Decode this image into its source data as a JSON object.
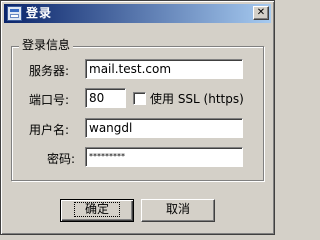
{
  "window": {
    "title": "登录",
    "close_glyph": "✕"
  },
  "group": {
    "label": "登录信息"
  },
  "form": {
    "server_label": "服务器:",
    "server_value": "mail.test.com",
    "port_label": "端口号:",
    "port_value": "80",
    "ssl_label": "使用 SSL (https)",
    "ssl_checked": false,
    "username_label": "用户名:",
    "username_value": "wangdl",
    "password_label": "密码:",
    "password_value": "*********"
  },
  "buttons": {
    "ok_label": "确定",
    "cancel_label": "取消"
  },
  "icons": {
    "title_icon": "app-window-icon",
    "close_icon": "close-icon"
  },
  "colors": {
    "titlebar_start": "#0a246a",
    "titlebar_end": "#a6caf0",
    "face": "#d4d0c8"
  }
}
